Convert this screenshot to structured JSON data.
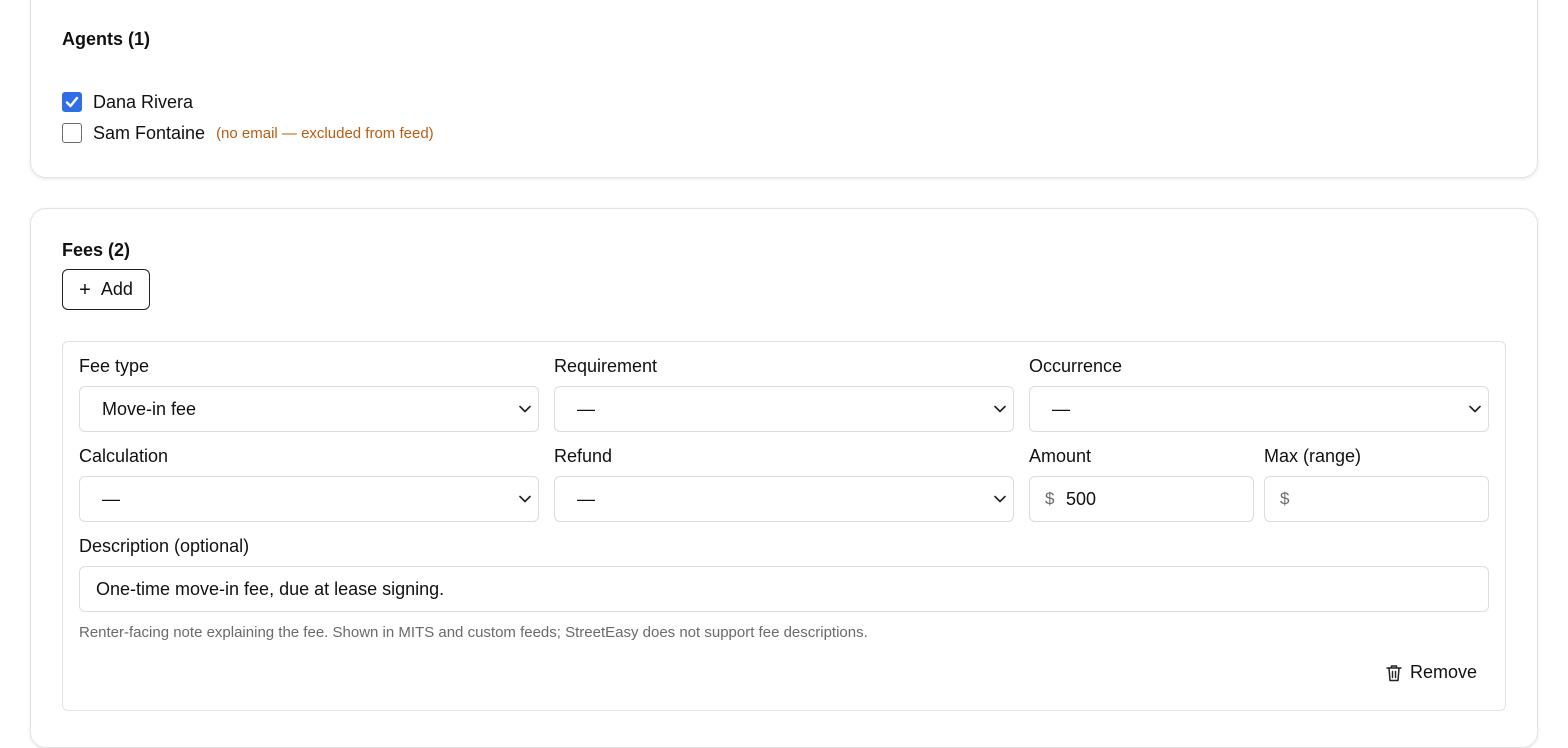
{
  "agents": {
    "title": "Agents (1)",
    "items": [
      {
        "name": "Dana Rivera",
        "checked": true,
        "note": ""
      },
      {
        "name": "Sam Fontaine",
        "checked": false,
        "note": "(no email — excluded from feed)"
      }
    ]
  },
  "fees": {
    "title": "Fees (2)",
    "add_label": "Add",
    "item": {
      "fee_type_label": "Fee type",
      "fee_type_value": "Move-in fee",
      "requirement_label": "Requirement",
      "requirement_value": "—",
      "occurrence_label": "Occurrence",
      "occurrence_value": "—",
      "calculation_label": "Calculation",
      "calculation_value": "—",
      "refund_label": "Refund",
      "refund_value": "—",
      "amount_label": "Amount",
      "amount_prefix": "$",
      "amount_value": "500",
      "max_label": "Max (range)",
      "max_prefix": "$",
      "max_value": "",
      "description_label": "Description (optional)",
      "description_value": "One-time move-in fee, due at lease signing.",
      "help_text": "Renter-facing note explaining the fee. Shown in MITS and custom feeds; StreetEasy does not support fee descriptions.",
      "remove_label": "Remove"
    }
  },
  "colors": {
    "checkbox_checked": "#2f6fe6",
    "warning_note": "#b85c12"
  }
}
